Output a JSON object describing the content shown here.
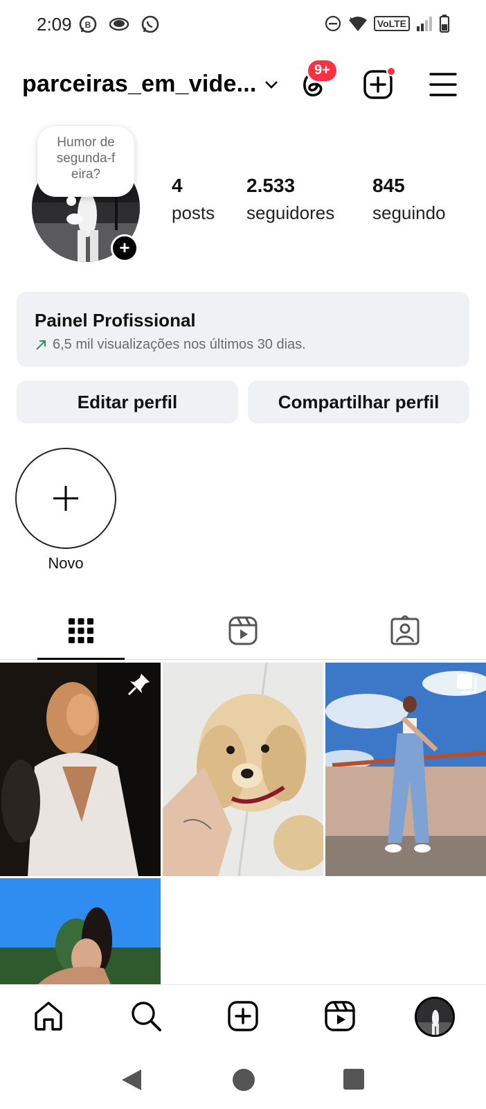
{
  "status_bar": {
    "time": "2:09",
    "icons_left": [
      "whatsapp-business-icon",
      "eye-icon",
      "whatsapp-icon"
    ],
    "icons_right": [
      "do-not-disturb-icon",
      "wifi-icon",
      "volte-badge",
      "signal-icon",
      "battery-icon"
    ],
    "volte_label": "VoLTE"
  },
  "header": {
    "username": "parceiras_em_vide...",
    "threads_badge": "9+",
    "accent_color": "#ff3040"
  },
  "profile": {
    "note_text": "Humor de segunda-f eira?",
    "stats": [
      {
        "value": "4",
        "label": "posts"
      },
      {
        "value": "2.533",
        "label": "seguidores"
      },
      {
        "value": "845",
        "label": "seguindo"
      }
    ]
  },
  "dashboard": {
    "title": "Painel Profissional",
    "subtitle": "6,5 mil visualizações nos últimos 30 dias.",
    "trend_color": "#1a9b47"
  },
  "buttons": {
    "edit": "Editar perfil",
    "share": "Compartilhar perfil"
  },
  "highlights": {
    "new_label": "Novo"
  },
  "tabs": [
    {
      "name": "grid-icon",
      "active": true
    },
    {
      "name": "reels-icon",
      "active": false
    },
    {
      "name": "tagged-icon",
      "active": false
    }
  ],
  "posts": [
    {
      "kind": "photo",
      "pinned": true
    },
    {
      "kind": "photo",
      "pinned": false
    },
    {
      "kind": "carousel",
      "pinned": false
    },
    {
      "kind": "photo",
      "pinned": false
    }
  ],
  "bottom_nav": [
    "home-icon",
    "search-icon",
    "create-icon",
    "reels-icon",
    "profile-avatar"
  ],
  "system_nav": [
    "back-button",
    "home-button",
    "recents-button"
  ]
}
